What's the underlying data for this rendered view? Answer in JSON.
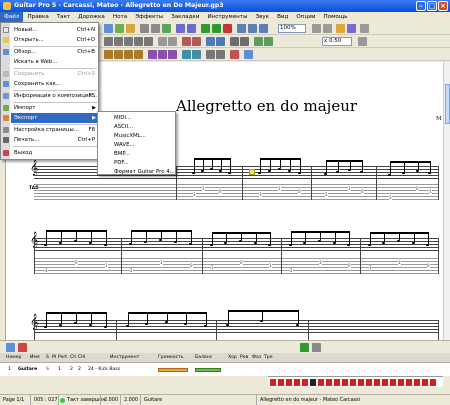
{
  "title": "Guitar Pro 5 - Carcassi, Mateo - Allegretto en Do Majeur.gp3",
  "menubar": [
    "Файл",
    "Правка",
    "Такт",
    "Дорожка",
    "Нота",
    "Эффекты",
    "Закладки",
    "Инструменты",
    "Звук",
    "Вид",
    "Опции",
    "Помощь"
  ],
  "toolbar": {
    "zoom": "100%",
    "tempo": "x 0.50"
  },
  "file_menu": {
    "items": [
      {
        "label": "Новый...",
        "shortcut": "Ctrl+N"
      },
      {
        "label": "Открыть...",
        "shortcut": "Ctrl+O"
      },
      {
        "label": "Обзор...",
        "shortcut": "Ctrl+B"
      },
      {
        "label": "Искать в Web...",
        "shortcut": ""
      },
      {
        "label": "Сохранить",
        "shortcut": "Ctrl+S"
      },
      {
        "label": "Сохранить как...",
        "shortcut": ""
      },
      {
        "label": "Информация о композиции...",
        "shortcut": "F5"
      },
      {
        "label": "Импорт",
        "shortcut": ""
      },
      {
        "label": "Экспорт",
        "shortcut": ""
      },
      {
        "label": "Настройка страницы...",
        "shortcut": "F8"
      },
      {
        "label": "Печать...",
        "shortcut": "Ctrl+P"
      },
      {
        "label": "Выход",
        "shortcut": ""
      }
    ]
  },
  "export_menu": {
    "items": [
      "MIDI...",
      "ASCII...",
      "MusicXML...",
      "WAVE...",
      "BMP...",
      "PDF...",
      "Формат Guitar Pro 4..."
    ]
  },
  "score": {
    "title": "Allegretto en do majeur",
    "composer": "M",
    "tab_label": "TAB"
  },
  "tracks": {
    "headers": [
      "Номер",
      "Имя",
      "S",
      "M",
      "Port",
      "Ch",
      "Chl",
      "Инструмент",
      "Громкость",
      "Баланс",
      "Хор",
      "Рев",
      "Фаз",
      "Тре"
    ],
    "row": {
      "number": "1",
      "name": "Guitare",
      "port": "1",
      "ch": "2",
      "chl": "2",
      "instrument": "24 - Kick Bass",
      "muted_label": "S"
    }
  },
  "status": {
    "page": "Page 1/1",
    "position": "005 : 027",
    "state": "Такт завершен",
    "time1": "2.000",
    "time2": "2.000",
    "track": "Guitare",
    "song": "Allegretto en do majeur - Mateo Carcassi"
  }
}
